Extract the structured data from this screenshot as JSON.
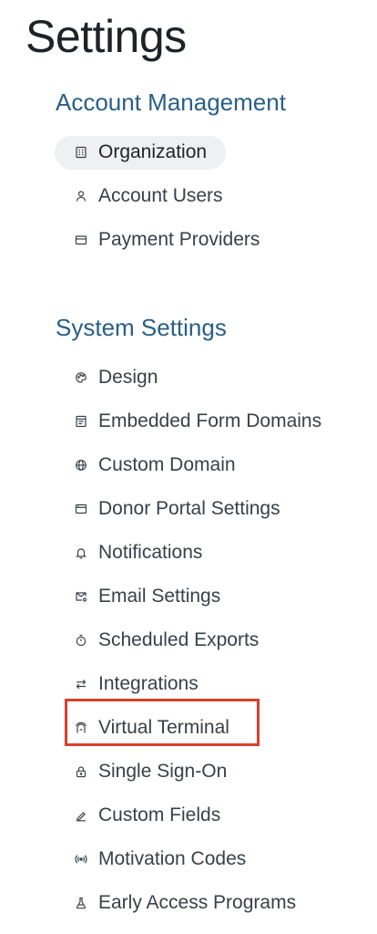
{
  "page": {
    "title": "Settings"
  },
  "sections": [
    {
      "heading": "Account Management",
      "items": [
        {
          "label": "Organization",
          "icon": "building-icon",
          "active": true
        },
        {
          "label": "Account Users",
          "icon": "user-icon"
        },
        {
          "label": "Payment Providers",
          "icon": "credit-card-icon"
        }
      ]
    },
    {
      "heading": "System Settings",
      "items": [
        {
          "label": "Design",
          "icon": "palette-icon"
        },
        {
          "label": "Embedded Form Domains",
          "icon": "form-icon"
        },
        {
          "label": "Custom Domain",
          "icon": "globe-icon"
        },
        {
          "label": "Donor Portal Settings",
          "icon": "browser-window-icon"
        },
        {
          "label": "Notifications",
          "icon": "bell-icon"
        },
        {
          "label": "Email Settings",
          "icon": "mail-settings-icon"
        },
        {
          "label": "Scheduled Exports",
          "icon": "stopwatch-icon"
        },
        {
          "label": "Integrations",
          "icon": "arrows-swap-icon"
        },
        {
          "label": "Virtual Terminal",
          "icon": "terminal-icon",
          "highlighted": true
        },
        {
          "label": "Single Sign-On",
          "icon": "lock-icon"
        },
        {
          "label": "Custom Fields",
          "icon": "pencil-icon"
        },
        {
          "label": "Motivation Codes",
          "icon": "broadcast-icon"
        },
        {
          "label": "Early Access Programs",
          "icon": "flask-icon"
        }
      ]
    }
  ],
  "colors": {
    "section_heading": "#2a5f86",
    "active_pill_bg": "#eef0f1",
    "highlight_border": "#d9402b"
  }
}
